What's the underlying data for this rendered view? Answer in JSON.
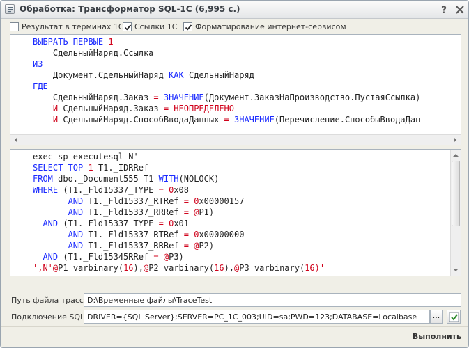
{
  "window": {
    "title": "Обработка: Трансформатор SQL-1С (6,995 с.)"
  },
  "options": [
    {
      "label": "Результат в терминах 1С",
      "checked": false
    },
    {
      "label": "Ссылки 1С",
      "checked": true
    },
    {
      "label": "Форматирование интернет-сервисом",
      "checked": true
    }
  ],
  "query_editor": {
    "lines": [
      [
        {
          "t": "ВЫБРАТЬ ПЕРВЫЕ ",
          "c": "kw"
        },
        {
          "t": "1",
          "c": "num"
        }
      ],
      [
        {
          "t": "    СдельныйНаряд.Ссылка",
          "c": "blk"
        }
      ],
      [
        {
          "t": "ИЗ",
          "c": "kw"
        }
      ],
      [
        {
          "t": "    Документ.СдельныйНаряд ",
          "c": "blk"
        },
        {
          "t": "КАК",
          "c": "kw"
        },
        {
          "t": " СдельныйНаряд",
          "c": "blk"
        }
      ],
      [
        {
          "t": "ГДЕ",
          "c": "kw"
        }
      ],
      [
        {
          "t": "    СдельныйНаряд.Заказ ",
          "c": "blk"
        },
        {
          "t": "= ",
          "c": "red"
        },
        {
          "t": "ЗНАЧЕНИЕ",
          "c": "kw"
        },
        {
          "t": "(Документ.ЗаказНаПроизводство.ПустаяСсылка)",
          "c": "blk"
        }
      ],
      [
        {
          "t": "    И",
          "c": "red"
        },
        {
          "t": " СдельныйНаряд.Заказ ",
          "c": "blk"
        },
        {
          "t": "= НЕОПРЕДЕЛЕНО",
          "c": "red"
        }
      ],
      [
        {
          "t": "    И",
          "c": "red"
        },
        {
          "t": " СдельныйНаряд.СпособВводаДанных ",
          "c": "blk"
        },
        {
          "t": "= ",
          "c": "red"
        },
        {
          "t": "ЗНАЧЕНИЕ",
          "c": "kw"
        },
        {
          "t": "(Перечисление.СпособыВводаДан",
          "c": "blk"
        }
      ]
    ]
  },
  "sql_editor": {
    "lines": [
      [
        {
          "t": "exec sp_executesql N'",
          "c": "blk"
        }
      ],
      [
        {
          "t": "SELECT TOP ",
          "c": "kw"
        },
        {
          "t": "1",
          "c": "num"
        },
        {
          "t": " T1._IDRRef",
          "c": "blk"
        }
      ],
      [
        {
          "t": "FROM",
          "c": "kw"
        },
        {
          "t": " dbo._Document555 T1 ",
          "c": "blk"
        },
        {
          "t": "WITH",
          "c": "kw"
        },
        {
          "t": "(NOLOCK)",
          "c": "blk"
        }
      ],
      [
        {
          "t": "WHERE",
          "c": "kw"
        },
        {
          "t": " (T1._Fld15337_TYPE ",
          "c": "blk"
        },
        {
          "t": "= ",
          "c": "red"
        },
        {
          "t": "0",
          "c": "num"
        },
        {
          "t": "x08",
          "c": "blk"
        }
      ],
      [
        {
          "t": "       AND",
          "c": "kw"
        },
        {
          "t": " T1._Fld15337_RTRef ",
          "c": "blk"
        },
        {
          "t": "= ",
          "c": "red"
        },
        {
          "t": "0",
          "c": "num"
        },
        {
          "t": "x00000157",
          "c": "blk"
        }
      ],
      [
        {
          "t": "       AND",
          "c": "kw"
        },
        {
          "t": " T1._Fld15337_RRRef ",
          "c": "blk"
        },
        {
          "t": "= @",
          "c": "red"
        },
        {
          "t": "P1)",
          "c": "blk"
        }
      ],
      [
        {
          "t": "  AND",
          "c": "kw"
        },
        {
          "t": " (T1._Fld15337_TYPE ",
          "c": "blk"
        },
        {
          "t": "= ",
          "c": "red"
        },
        {
          "t": "0",
          "c": "num"
        },
        {
          "t": "x01",
          "c": "blk"
        }
      ],
      [
        {
          "t": "       AND",
          "c": "kw"
        },
        {
          "t": " T1._Fld15337_RTRef ",
          "c": "blk"
        },
        {
          "t": "= ",
          "c": "red"
        },
        {
          "t": "0",
          "c": "num"
        },
        {
          "t": "x00000000",
          "c": "blk"
        }
      ],
      [
        {
          "t": "       AND",
          "c": "kw"
        },
        {
          "t": " T1._Fld15337_RRRef ",
          "c": "blk"
        },
        {
          "t": "= @",
          "c": "red"
        },
        {
          "t": "P2)",
          "c": "blk"
        }
      ],
      [
        {
          "t": "  AND",
          "c": "kw"
        },
        {
          "t": " (T1._Fld15345RRef ",
          "c": "blk"
        },
        {
          "t": "= @",
          "c": "red"
        },
        {
          "t": "P3)",
          "c": "blk"
        }
      ],
      [
        {
          "t": "',N'",
          "c": "red"
        },
        {
          "t": "@",
          "c": "red"
        },
        {
          "t": "P1 varbinary(",
          "c": "blk"
        },
        {
          "t": "16",
          "c": "num"
        },
        {
          "t": "),",
          "c": "blk"
        },
        {
          "t": "@",
          "c": "red"
        },
        {
          "t": "P2 varbinary(",
          "c": "blk"
        },
        {
          "t": "16",
          "c": "num"
        },
        {
          "t": "),",
          "c": "blk"
        },
        {
          "t": "@",
          "c": "red"
        },
        {
          "t": "P3 varbinary(",
          "c": "blk"
        },
        {
          "t": "16",
          "c": "num"
        },
        {
          "t": ")'",
          "c": "red"
        }
      ]
    ]
  },
  "trace_path": {
    "label": "Путь файла трассы:",
    "value": "D:\\Временные файлы\\TraceTest"
  },
  "sql_connection": {
    "label": "Подключение SQL:",
    "value": "DRIVER={SQL Server};SERVER=PC_1C_003;UID=sa;PWD=123;DATABASE=Localbase",
    "dots_label": "..."
  },
  "footer": {
    "run_label": "Выполнить"
  },
  "colors": {
    "keyword": "#1a2aff",
    "number": "#d0021b",
    "operator": "#d0021b",
    "text": "#222222"
  },
  "icons": {
    "title": "form-icon",
    "help": "help-icon",
    "close": "close-icon",
    "check": "checkmark-icon"
  }
}
